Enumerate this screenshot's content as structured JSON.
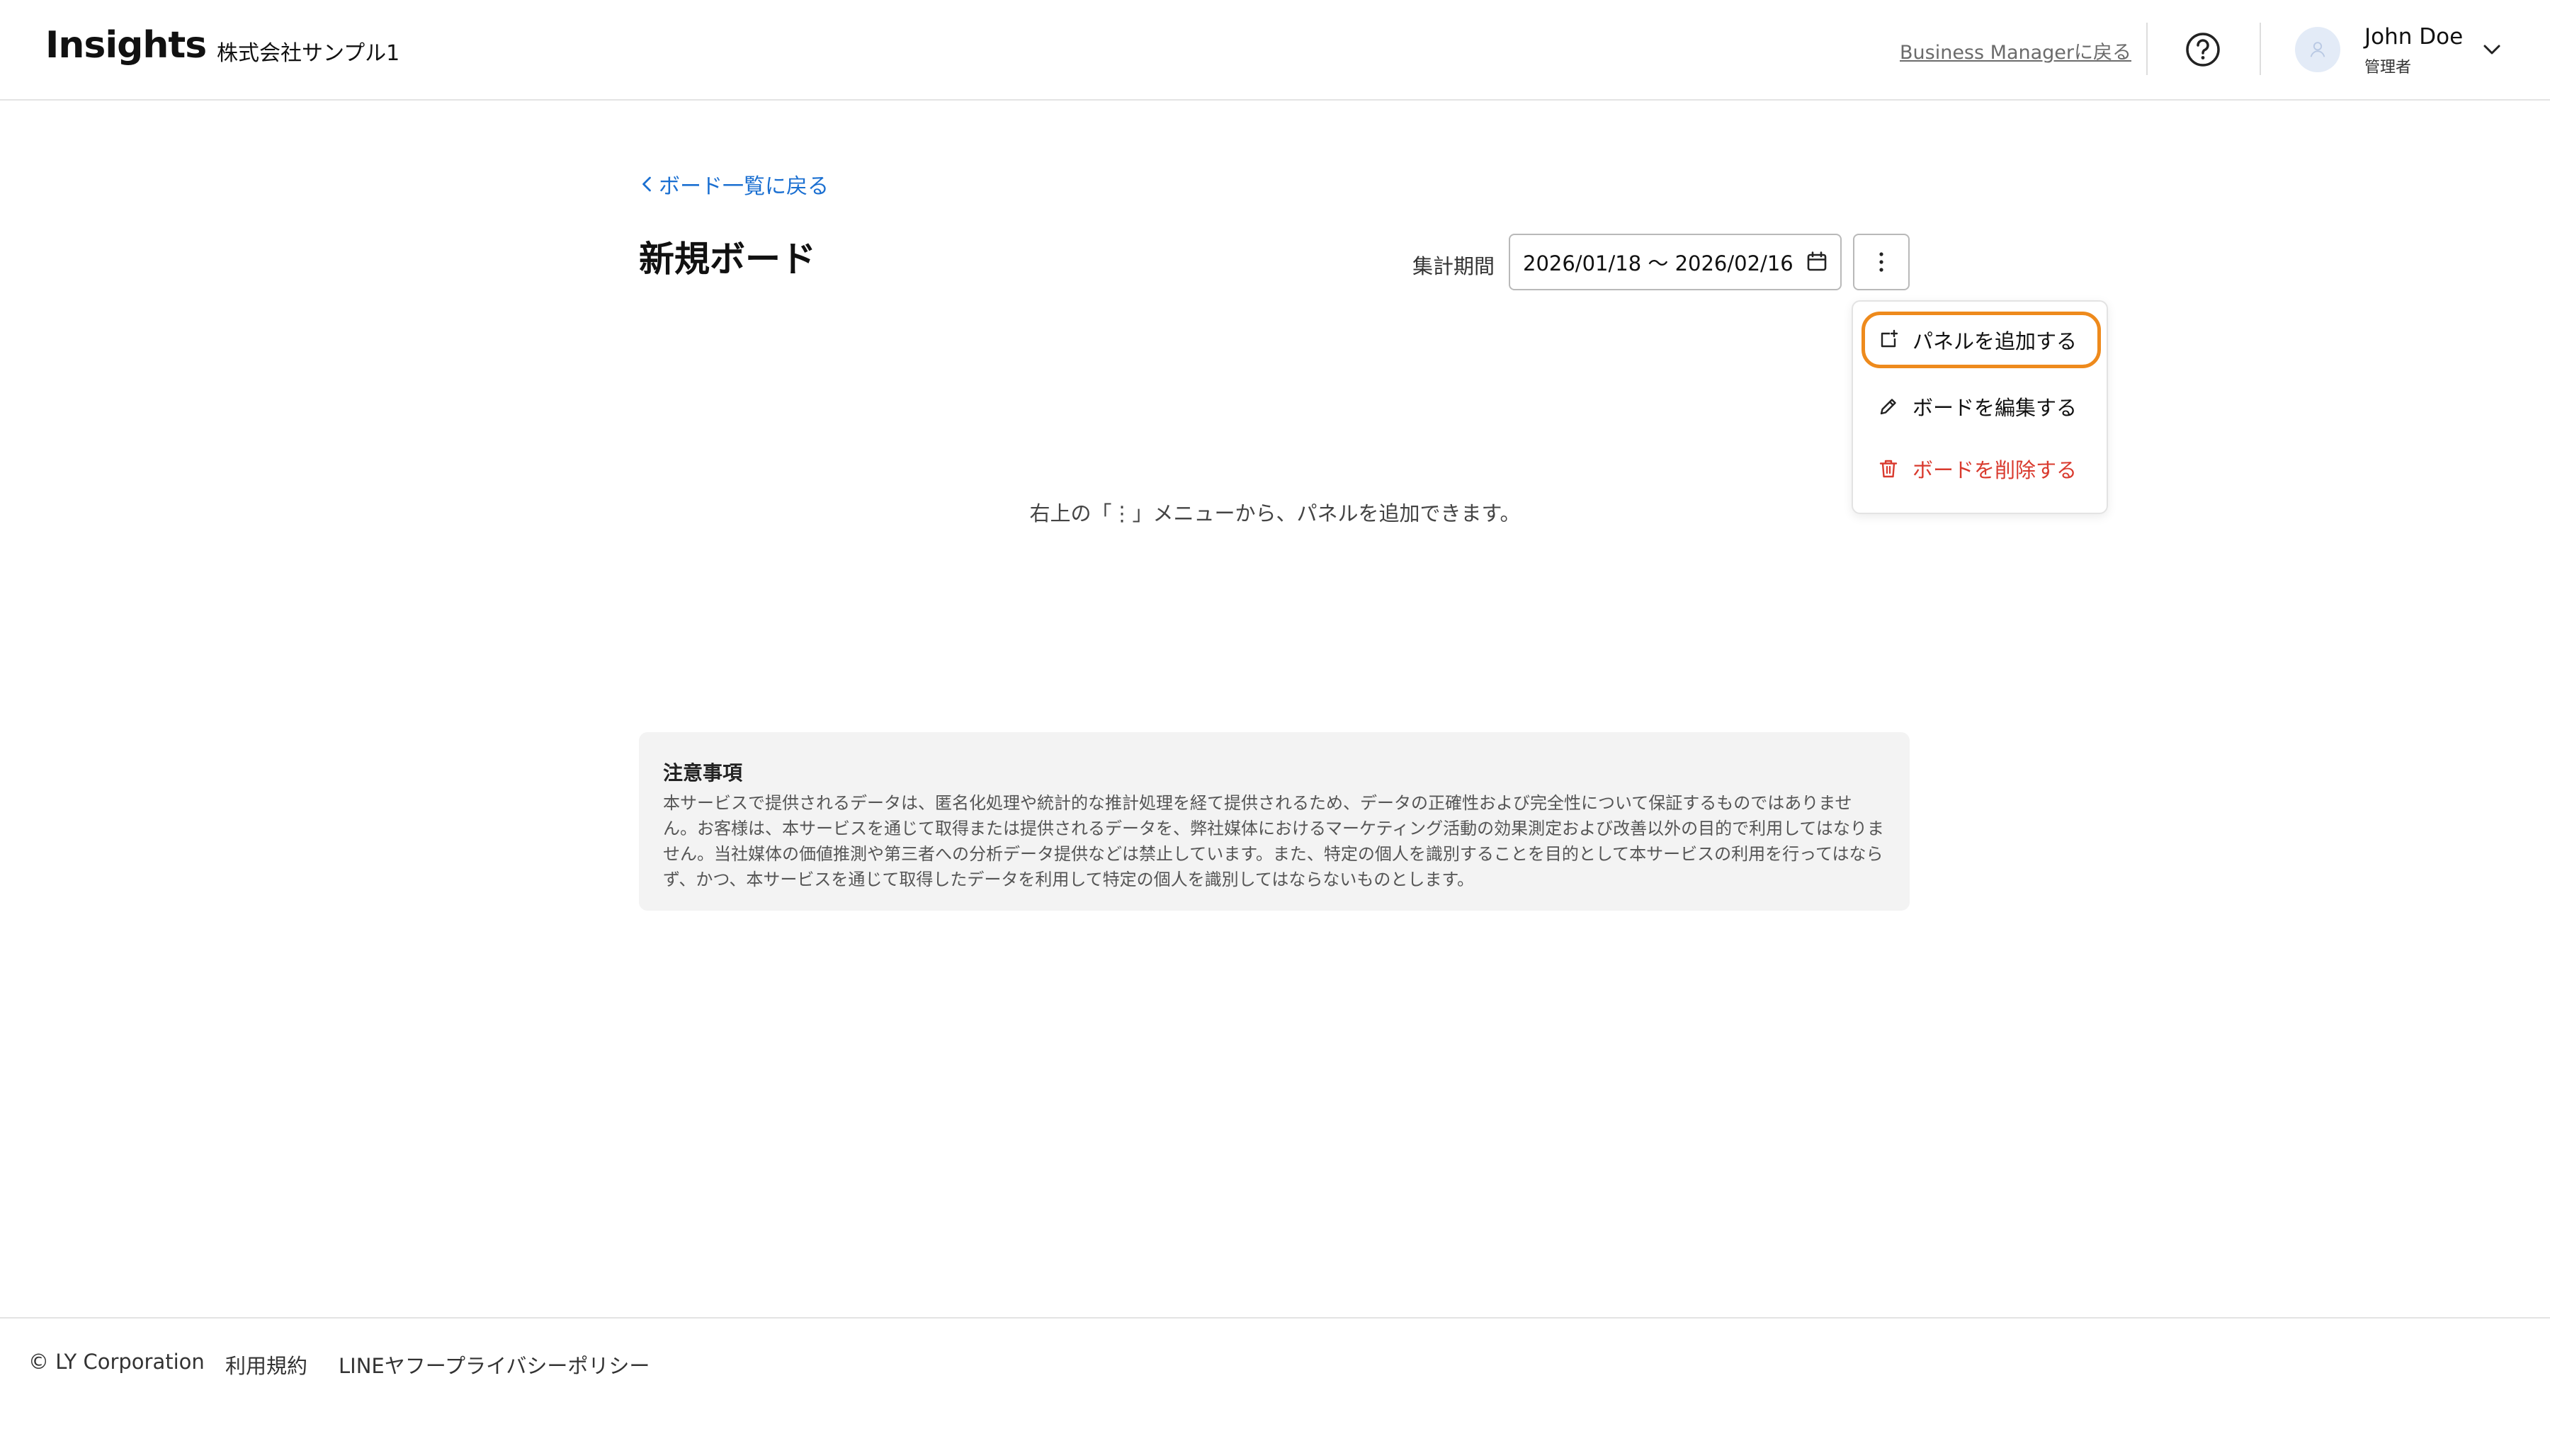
{
  "header": {
    "logo": "Insights",
    "company": "株式会社サンプル1",
    "back_to_bm": "Business Managerに戻る",
    "user_name": "John Doe",
    "user_role": "管理者"
  },
  "main": {
    "back_link": "ボード一覧に戻る",
    "title": "新規ボード",
    "period_label": "集計期間",
    "date_range": "2026/01/18 〜 2026/02/16",
    "empty_message": "右上の「⋮」メニューから、パネルを追加できます。"
  },
  "menu": {
    "add_panel": "パネルを追加する",
    "edit_board": "ボードを編集する",
    "delete_board": "ボードを削除する"
  },
  "notice": {
    "title": "注意事項",
    "body": "本サービスで提供されるデータは、匿名化処理や統計的な推計処理を経て提供されるため、データの正確性および完全性について保証するものではありません。お客様は、本サービスを通じて取得または提供されるデータを、弊社媒体におけるマーケティング活動の効果測定および改善以外の目的で利用してはなりません。当社媒体の価値推測や第三者への分析データ提供などは禁止しています。また、特定の個人を識別することを目的として本サービスの利用を行ってはならず、かつ、本サービスを通じて取得したデータを利用して特定の個人を識別してはならないものとします。"
  },
  "footer": {
    "copyright": "© LY Corporation",
    "terms": "利用規約",
    "privacy": "LINEヤフープライバシーポリシー"
  },
  "colors": {
    "link": "#1a6fd1",
    "danger": "#d93a2e",
    "highlight": "#ee8a1c"
  }
}
